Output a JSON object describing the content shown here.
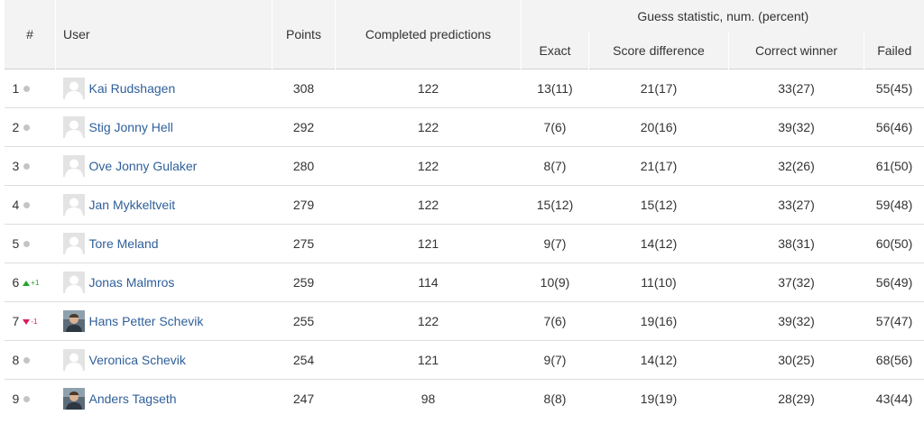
{
  "headers": {
    "rank": "#",
    "user": "User",
    "points": "Points",
    "completed": "Completed predictions",
    "guess_group": "Guess statistic, num. (percent)",
    "exact": "Exact",
    "score_diff": "Score difference",
    "correct_winner": "Correct winner",
    "failed": "Failed"
  },
  "colors": {
    "link": "#2f5f9a",
    "up": "#22a52a",
    "down": "#d81b60",
    "header_bg": "#f3f3f3"
  },
  "rows": [
    {
      "rank": "1",
      "move": "none",
      "name": "Kai Rudshagen",
      "avatar": "placeholder",
      "points": "308",
      "completed": "122",
      "exact": "13(11)",
      "score_diff": "21(17)",
      "correct_winner": "33(27)",
      "failed": "55(45)"
    },
    {
      "rank": "2",
      "move": "none",
      "name": "Stig Jonny Hell",
      "avatar": "placeholder",
      "points": "292",
      "completed": "122",
      "exact": "7(6)",
      "score_diff": "20(16)",
      "correct_winner": "39(32)",
      "failed": "56(46)"
    },
    {
      "rank": "3",
      "move": "none",
      "name": "Ove Jonny Gulaker",
      "avatar": "placeholder",
      "points": "280",
      "completed": "122",
      "exact": "8(7)",
      "score_diff": "21(17)",
      "correct_winner": "32(26)",
      "failed": "61(50)"
    },
    {
      "rank": "4",
      "move": "none",
      "name": "Jan Mykkeltveit",
      "avatar": "placeholder",
      "points": "279",
      "completed": "122",
      "exact": "15(12)",
      "score_diff": "15(12)",
      "correct_winner": "33(27)",
      "failed": "59(48)"
    },
    {
      "rank": "5",
      "move": "none",
      "name": "Tore Meland",
      "avatar": "placeholder",
      "points": "275",
      "completed": "121",
      "exact": "9(7)",
      "score_diff": "14(12)",
      "correct_winner": "38(31)",
      "failed": "60(50)"
    },
    {
      "rank": "6",
      "move": "up",
      "move_label": "+1",
      "name": "Jonas Malmros",
      "avatar": "placeholder",
      "points": "259",
      "completed": "114",
      "exact": "10(9)",
      "score_diff": "11(10)",
      "correct_winner": "37(32)",
      "failed": "56(49)"
    },
    {
      "rank": "7",
      "move": "down",
      "move_label": "-1",
      "name": "Hans Petter Schevik",
      "avatar": "photo",
      "points": "255",
      "completed": "122",
      "exact": "7(6)",
      "score_diff": "19(16)",
      "correct_winner": "39(32)",
      "failed": "57(47)"
    },
    {
      "rank": "8",
      "move": "none",
      "name": "Veronica Schevik",
      "avatar": "placeholder",
      "points": "254",
      "completed": "121",
      "exact": "9(7)",
      "score_diff": "14(12)",
      "correct_winner": "30(25)",
      "failed": "68(56)"
    },
    {
      "rank": "9",
      "move": "none",
      "name": "Anders Tagseth",
      "avatar": "photo",
      "points": "247",
      "completed": "98",
      "exact": "8(8)",
      "score_diff": "19(19)",
      "correct_winner": "28(29)",
      "failed": "43(44)"
    }
  ]
}
